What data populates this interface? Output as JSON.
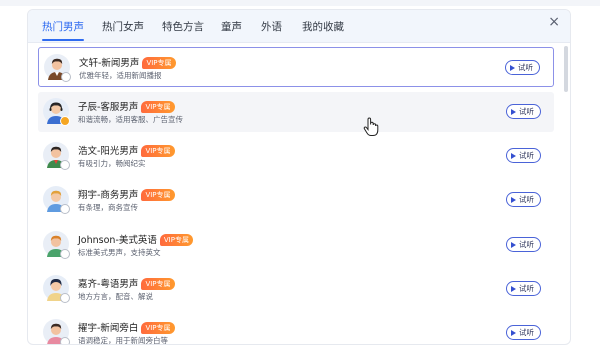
{
  "tabs": [
    {
      "label": "热门男声",
      "active": true
    },
    {
      "label": "热门女声",
      "active": false
    },
    {
      "label": "特色方言",
      "active": false
    },
    {
      "label": "童声",
      "active": false
    },
    {
      "label": "外语",
      "active": false
    },
    {
      "label": "我的收藏",
      "active": false
    }
  ],
  "close_icon": "×",
  "voices": [
    {
      "name": "文轩-新闻男声",
      "badge": "VIP专属",
      "desc": "优雅年轻，适用新闻播报",
      "listen": "试听",
      "state": "selected",
      "avatar": "man-brown-suit"
    },
    {
      "name": "子辰-客服男声",
      "badge": "VIP专属",
      "desc": "和谐流畅，适用客服、广告宣传",
      "listen": "试听",
      "state": "hovered",
      "avatar": "man-blue-headset"
    },
    {
      "name": "浩文-阳光男声",
      "badge": "VIP专属",
      "desc": "有吸引力，畅阅纪实",
      "listen": "试听",
      "state": "normal",
      "avatar": "man-green-jacket"
    },
    {
      "name": "翔宇-商务男声",
      "badge": "VIP专属",
      "desc": "有条理，商务宣传",
      "listen": "试听",
      "state": "normal",
      "avatar": "man-blue-shirt"
    },
    {
      "name": "Johnson-美式英语",
      "badge": "VIP专属",
      "desc": "标准美式男声，支持英文",
      "listen": "试听",
      "state": "normal",
      "avatar": "man-green-shirt"
    },
    {
      "name": "嘉齐-粤语男声",
      "badge": "VIP专属",
      "desc": "地方方言，配音、解说",
      "listen": "试听",
      "state": "normal",
      "avatar": "man-dark-hair"
    },
    {
      "name": "擢宇-新闻旁白",
      "badge": "VIP专属",
      "desc": "语调稳定，用于新闻旁白等",
      "listen": "试听",
      "state": "normal",
      "avatar": "man-pink-shirt"
    }
  ],
  "colors": {
    "accent": "#2f6bf0",
    "vip_start": "#ff6a3d",
    "vip_end": "#ff9a2e",
    "selected_border": "#8c91e8",
    "listen_border": "#4a63d8"
  }
}
